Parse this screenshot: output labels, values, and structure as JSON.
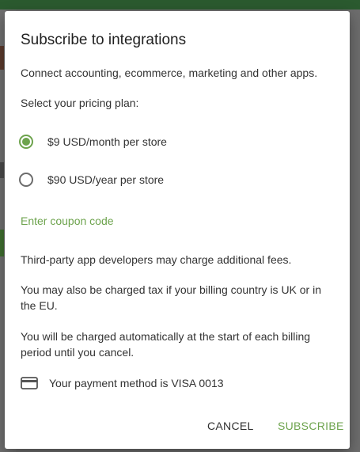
{
  "dialog": {
    "title": "Subscribe to integrations",
    "subtitle": "Connect accounting, ecommerce, marketing and other apps.",
    "plan_prompt": "Select your pricing plan:",
    "plans": [
      {
        "label": "$9 USD/month per store",
        "selected": true
      },
      {
        "label": "$90 USD/year per store",
        "selected": false
      }
    ],
    "coupon_link": "Enter coupon code",
    "notes": [
      "Third-party app developers may charge additional fees.",
      "You may also be charged tax if your billing country is UK or in the EU.",
      "You will be charged automatically at the start of each billing period until you cancel."
    ],
    "payment_method": "Your payment method is VISA 0013",
    "buttons": {
      "cancel": "CANCEL",
      "subscribe": "SUBSCRIBE"
    }
  },
  "colors": {
    "accent": "#6da34d",
    "topbar": "#2b5a2f"
  },
  "icons": {
    "payment": "credit-card-icon"
  }
}
